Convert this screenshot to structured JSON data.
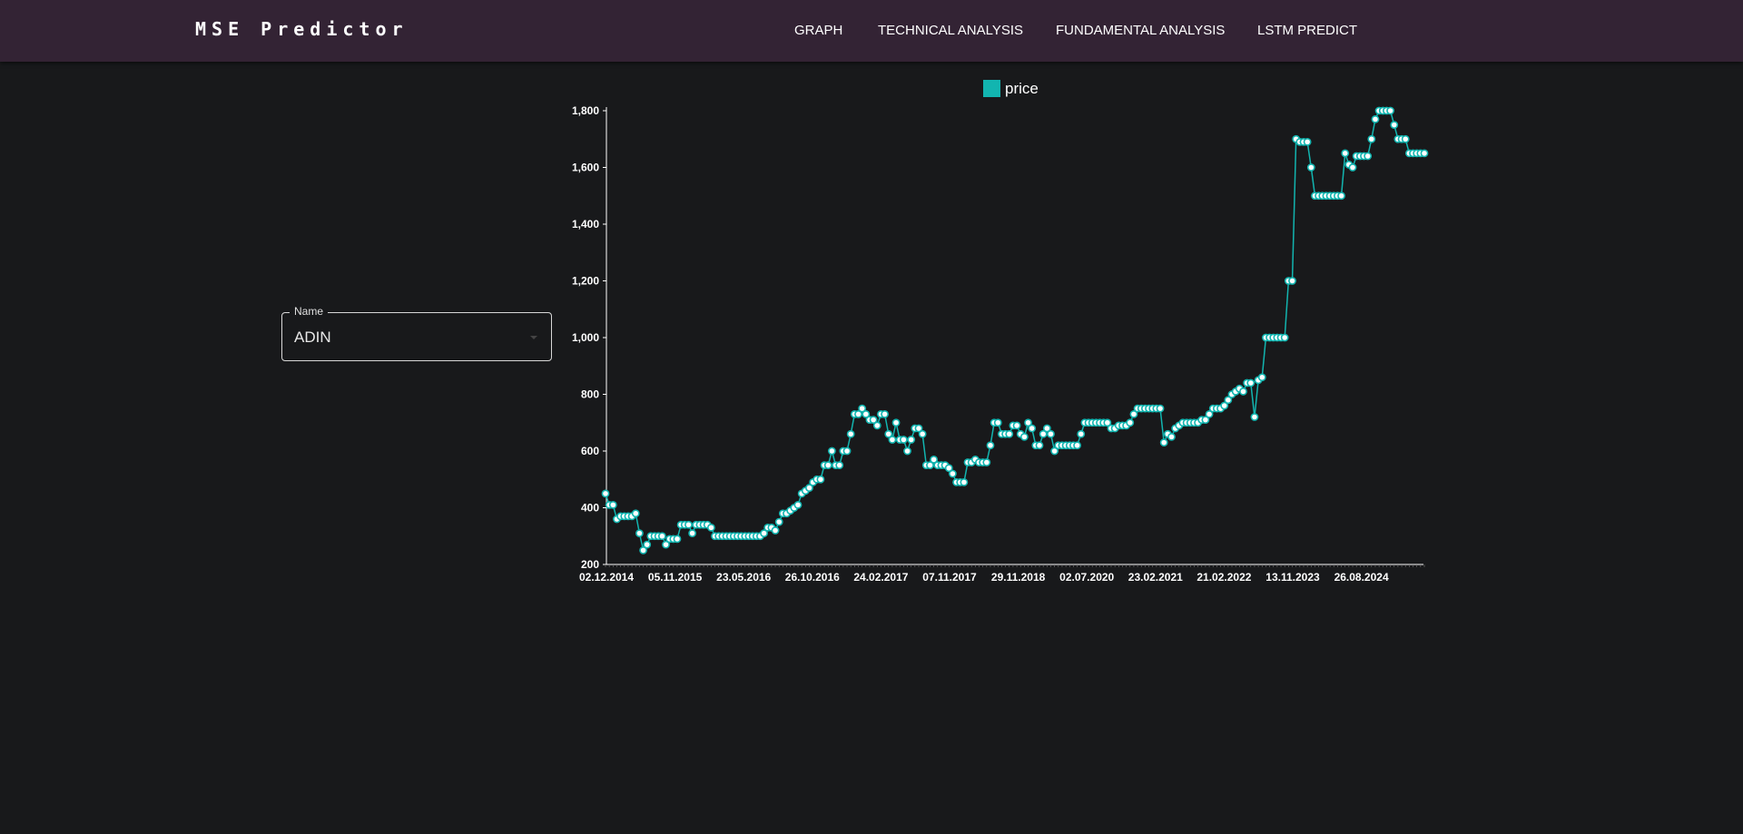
{
  "app": {
    "brand": "MSE Predictor",
    "nav": [
      {
        "label": "GRAPH"
      },
      {
        "label": "TECHNICAL ANALYSIS"
      },
      {
        "label": "FUNDAMENTAL ANALYSIS"
      },
      {
        "label": "LSTM PREDICT"
      }
    ]
  },
  "selector": {
    "label": "Name",
    "value": "ADIN"
  },
  "colors": {
    "background": "#18191b",
    "appbar": "#332334",
    "series": "#12b5b0",
    "marker_fill": "#ffffff"
  },
  "chart_data": {
    "type": "line",
    "legend": {
      "label": "price",
      "placement": "top-center"
    },
    "x_tick_labels": [
      "02.12.2014",
      "05.11.2015",
      "23.05.2016",
      "26.10.2016",
      "24.02.2017",
      "07.11.2017",
      "29.11.2018",
      "02.07.2020",
      "23.02.2021",
      "21.02.2022",
      "13.11.2023",
      "26.08.2024"
    ],
    "y_ticks": [
      200,
      400,
      600,
      800,
      1000,
      1200,
      1400,
      1600,
      1800
    ],
    "ylim": [
      200,
      1800
    ],
    "y_tick_labels": [
      "200",
      "400",
      "600",
      "800",
      "1,000",
      "1,200",
      "1,400",
      "1,600",
      "1,800"
    ],
    "grid": false,
    "series": [
      {
        "name": "price",
        "values": [
          450,
          410,
          410,
          360,
          370,
          370,
          370,
          370,
          380,
          310,
          250,
          270,
          300,
          300,
          300,
          300,
          270,
          290,
          290,
          290,
          340,
          340,
          340,
          310,
          340,
          340,
          340,
          340,
          330,
          300,
          300,
          300,
          300,
          300,
          300,
          300,
          300,
          300,
          300,
          300,
          300,
          300,
          310,
          330,
          330,
          320,
          350,
          380,
          380,
          390,
          400,
          410,
          450,
          460,
          470,
          490,
          500,
          500,
          550,
          550,
          600,
          550,
          550,
          600,
          600,
          660,
          730,
          730,
          750,
          730,
          710,
          710,
          690,
          730,
          730,
          660,
          640,
          700,
          640,
          640,
          600,
          640,
          680,
          680,
          660,
          550,
          550,
          570,
          550,
          550,
          550,
          540,
          520,
          490,
          490,
          490,
          560,
          560,
          570,
          560,
          560,
          560,
          620,
          700,
          700,
          660,
          660,
          660,
          690,
          690,
          660,
          650,
          700,
          680,
          620,
          620,
          660,
          680,
          660,
          600,
          620,
          620,
          620,
          620,
          620,
          620,
          660,
          700,
          700,
          700,
          700,
          700,
          700,
          700,
          680,
          680,
          690,
          690,
          690,
          700,
          730,
          750,
          750,
          750,
          750,
          750,
          750,
          750,
          630,
          660,
          650,
          680,
          690,
          700,
          700,
          700,
          700,
          700,
          710,
          710,
          730,
          750,
          750,
          750,
          760,
          780,
          800,
          810,
          820,
          810,
          840,
          840,
          720,
          850,
          860,
          1000,
          1000,
          1000,
          1000,
          1000,
          1000,
          1200,
          1200,
          1700,
          1690,
          1690,
          1690,
          1600,
          1500,
          1500,
          1500,
          1500,
          1500,
          1500,
          1500,
          1500,
          1650,
          1610,
          1600,
          1640,
          1640,
          1640,
          1640,
          1700,
          1770,
          1800,
          1800,
          1800,
          1800,
          1750,
          1700,
          1700,
          1700,
          1650,
          1650,
          1650,
          1650,
          1650
        ]
      }
    ]
  }
}
